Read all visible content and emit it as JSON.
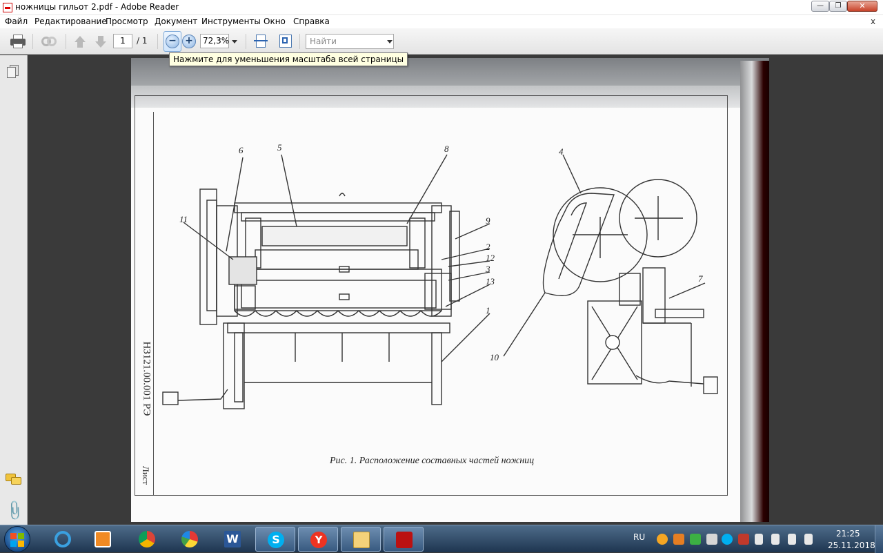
{
  "window": {
    "title": "ножницы гильот 2.pdf - Adobe Reader"
  },
  "menu": {
    "items": [
      "Файл",
      "Редактирование",
      "Просмотр",
      "Документ",
      "Инструменты",
      "Окно",
      "Справка"
    ],
    "close_x": "x"
  },
  "toolbar": {
    "page_current": "1",
    "page_total": "/ 1",
    "zoom_value": "72,3%",
    "search_placeholder": "Найти"
  },
  "tooltip": {
    "text": "Нажмите для уменьшения масштаба всей страницы"
  },
  "document": {
    "caption": "Рис. 1. Расположение составных частей ножниц",
    "stamp": "НЗ121.00.001 РЭ",
    "sheet_label": "Лист",
    "callouts": [
      "6",
      "5",
      "8",
      "9",
      "2",
      "12",
      "3",
      "13",
      "1",
      "11",
      "4",
      "7",
      "10"
    ]
  },
  "taskbar": {
    "language": "RU",
    "time": "21:25",
    "date": "25.11.2018",
    "items": [
      "internet-explorer-icon",
      "media-player-icon",
      "chrome-icon",
      "yandex-browser-icon",
      "word-icon",
      "skype-icon",
      "yandex-icon",
      "file-explorer-icon",
      "adobe-reader-icon"
    ],
    "accent": "#1e3550"
  }
}
